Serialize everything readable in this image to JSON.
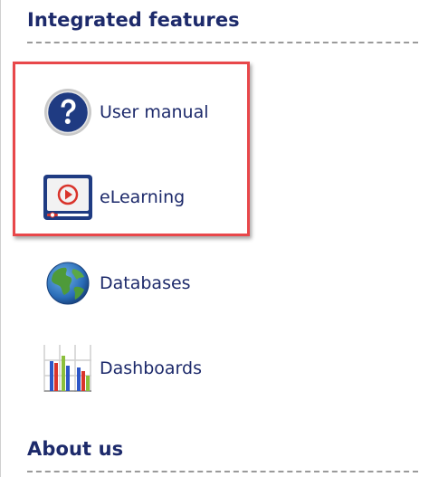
{
  "integrated_features": {
    "title": "Integrated features",
    "items": [
      {
        "label": "User manual",
        "icon": "question-mark-icon"
      },
      {
        "label": "eLearning",
        "icon": "video-play-icon"
      },
      {
        "label": "Databases",
        "icon": "globe-icon"
      },
      {
        "label": "Dashboards",
        "icon": "bar-chart-icon"
      }
    ]
  },
  "about_us": {
    "title": "About us"
  },
  "colors": {
    "heading": "#1d2a6b",
    "highlight": "#e8474a",
    "divider": "#9a9a9a"
  }
}
